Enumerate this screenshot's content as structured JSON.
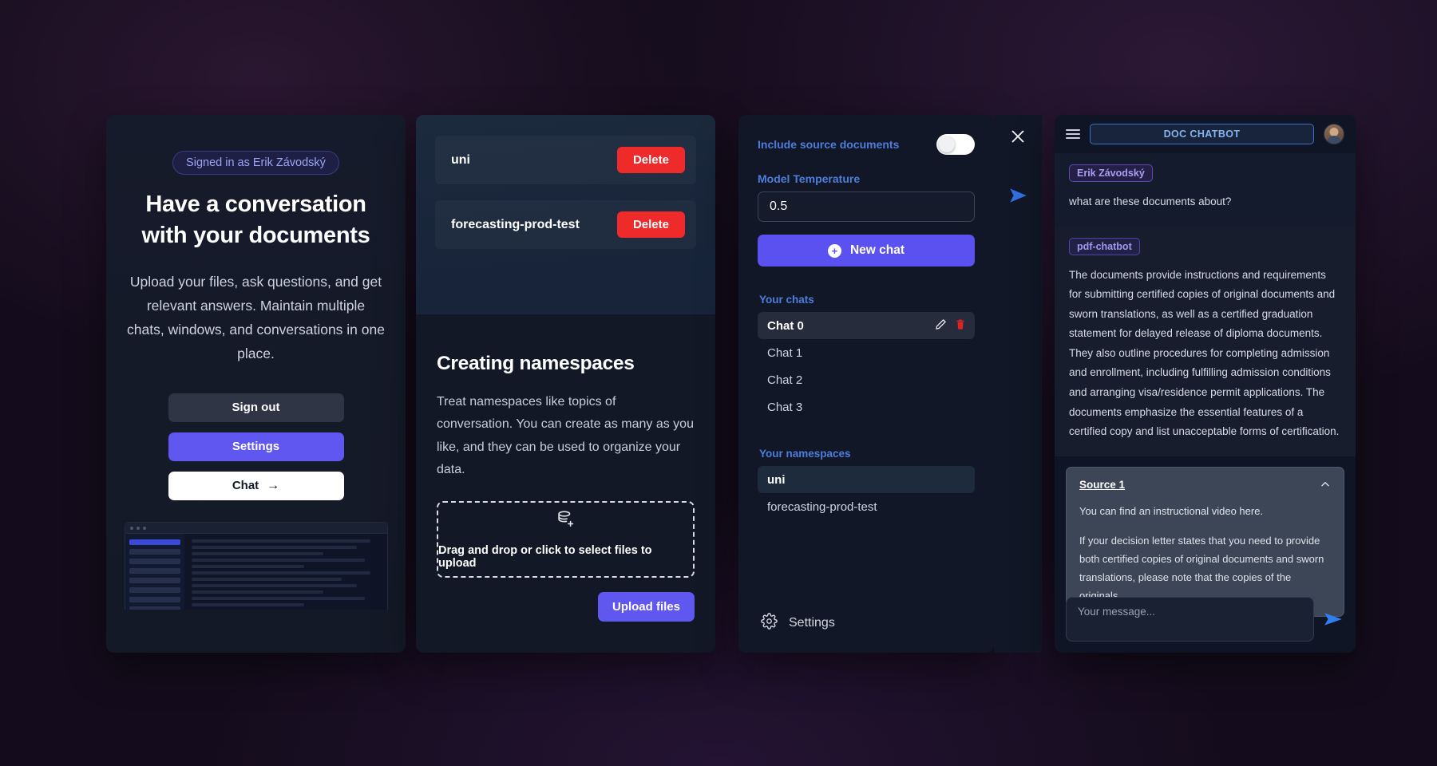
{
  "hero": {
    "signed_in_badge": "Signed in as Erik Závodský",
    "title_line1": "Have a conversation",
    "title_line2": "with your documents",
    "subtitle": "Upload your files, ask questions, and get relevant answers. Maintain multiple chats, windows, and conversations in one place.",
    "buttons": {
      "sign_out": "Sign out",
      "settings": "Settings",
      "chat": "Chat",
      "chat_arrow_icon": "arrow-right-icon"
    }
  },
  "namespaces_panel": {
    "rows": [
      {
        "name": "uni",
        "delete_label": "Delete"
      },
      {
        "name": "forecasting-prod-test",
        "delete_label": "Delete"
      }
    ],
    "heading": "Creating namespaces",
    "paragraph": "Treat namespaces like topics of conversation. You can create as many as you like, and they can be used to organize your data.",
    "dropzone": {
      "icon": "database-plus-icon",
      "label": "Drag and drop or click to select files to upload"
    },
    "upload_label": "Upload files"
  },
  "settings_panel": {
    "include_source_documents_label": "Include source documents",
    "include_source_documents_on": false,
    "model_temperature_label": "Model Temperature",
    "model_temperature_value": "0.5",
    "new_chat_label": "New chat",
    "new_chat_icon": "plus-circle-icon",
    "your_chats_label": "Your chats",
    "chats": [
      {
        "label": "Chat 0",
        "active": true,
        "edit_icon": "pencil-icon",
        "delete_icon": "trash-icon"
      },
      {
        "label": "Chat 1",
        "active": false
      },
      {
        "label": "Chat 2",
        "active": false
      },
      {
        "label": "Chat 3",
        "active": false
      }
    ],
    "your_namespaces_label": "Your namespaces",
    "namespaces": [
      {
        "label": "uni",
        "active": true
      },
      {
        "label": "forecasting-prod-test",
        "active": false
      }
    ],
    "settings_label": "Settings",
    "settings_icon": "gear-icon",
    "close_icon": "close-icon",
    "send_icon": "send-icon"
  },
  "chat_panel": {
    "menu_icon": "hamburger-menu-icon",
    "title": "DOC CHATBOT",
    "avatar_icon": "user-avatar",
    "messages": [
      {
        "author": "Erik Závodský",
        "role": "user",
        "text": "what are these documents about?"
      },
      {
        "author": "pdf-chatbot",
        "role": "bot",
        "text": "The documents provide instructions and requirements for submitting certified copies of original documents and sworn translations, as well as a certified graduation statement for delayed release of diploma documents. They also outline procedures for completing admission and enrollment, including fulfilling admission conditions and arranging visa/residence permit applications. The documents emphasize the essential features of a certified copy and list unacceptable forms of certification."
      }
    ],
    "source": {
      "title": "Source 1",
      "collapse_icon": "chevron-up-icon",
      "paragraph_1": "You can find an instructional video here.",
      "paragraph_2": "If your decision letter states that you need to provide both certified copies of original documents and sworn translations, please note that the copies of the originals"
    },
    "composer": {
      "placeholder": "Your message...",
      "send_icon": "send-icon"
    }
  },
  "colors": {
    "accent_purple": "#6057f0",
    "accent_blue": "#4e7ddb",
    "danger_red": "#ef2a2a",
    "panel_bg": "#121826"
  }
}
